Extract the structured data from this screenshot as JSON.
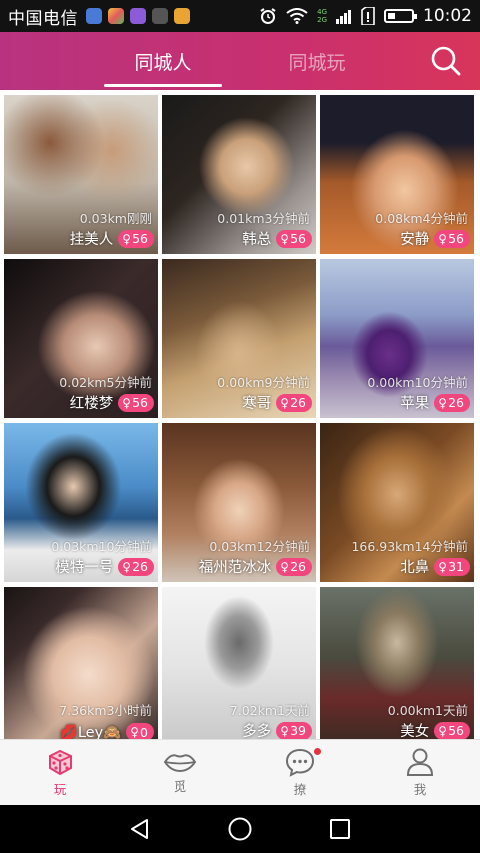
{
  "status_bar": {
    "carrier": "中国电信",
    "time": "10:02",
    "net_top": "4G",
    "net_bottom": "2G"
  },
  "header": {
    "tabs": [
      {
        "label": "同城人",
        "active": true
      },
      {
        "label": "同城玩",
        "active": false
      }
    ],
    "search_icon": "search-icon"
  },
  "users": [
    {
      "name": "挂美人",
      "dist": "0.03km",
      "time": "刚刚",
      "age": "56"
    },
    {
      "name": "韩总",
      "dist": "0.01km",
      "time": "3分钟前",
      "age": "56"
    },
    {
      "name": "安静",
      "dist": "0.08km",
      "time": "4分钟前",
      "age": "56"
    },
    {
      "name": "红楼梦",
      "dist": "0.02km",
      "time": "5分钟前",
      "age": "56"
    },
    {
      "name": "寒哥",
      "dist": "0.00km",
      "time": "9分钟前",
      "age": "26"
    },
    {
      "name": "苹果",
      "dist": "0.00km",
      "time": "10分钟前",
      "age": "26"
    },
    {
      "name": "模特一号",
      "dist": "0.03km",
      "time": "10分钟前",
      "age": "26"
    },
    {
      "name": "福州范冰冰",
      "dist": "0.03km",
      "time": "12分钟前",
      "age": "26"
    },
    {
      "name": "北鼻",
      "dist": "166.93km",
      "time": "14分钟前",
      "age": "31"
    },
    {
      "name": "Ley",
      "dist": "7.36km",
      "time": "3小时前",
      "age": "0",
      "prefix": "💋",
      "suffix": "🙈"
    },
    {
      "name": "多多",
      "dist": "7.02km",
      "time": "1天前",
      "age": "39"
    },
    {
      "name": "美女",
      "dist": "0.00km",
      "time": "1天前",
      "age": "56"
    }
  ],
  "bottom_nav": [
    {
      "label": "玩",
      "icon": "dice-icon",
      "active": true
    },
    {
      "label": "觅",
      "icon": "lips-icon",
      "active": false
    },
    {
      "label": "撩",
      "icon": "chat-bubble-icon",
      "active": false,
      "has_dot": true
    },
    {
      "label": "我",
      "icon": "person-icon",
      "active": false
    }
  ],
  "colors": {
    "header_start": "#b8337f",
    "header_end": "#d8355a",
    "accent": "#e63b70",
    "badge": "#f2477e"
  }
}
